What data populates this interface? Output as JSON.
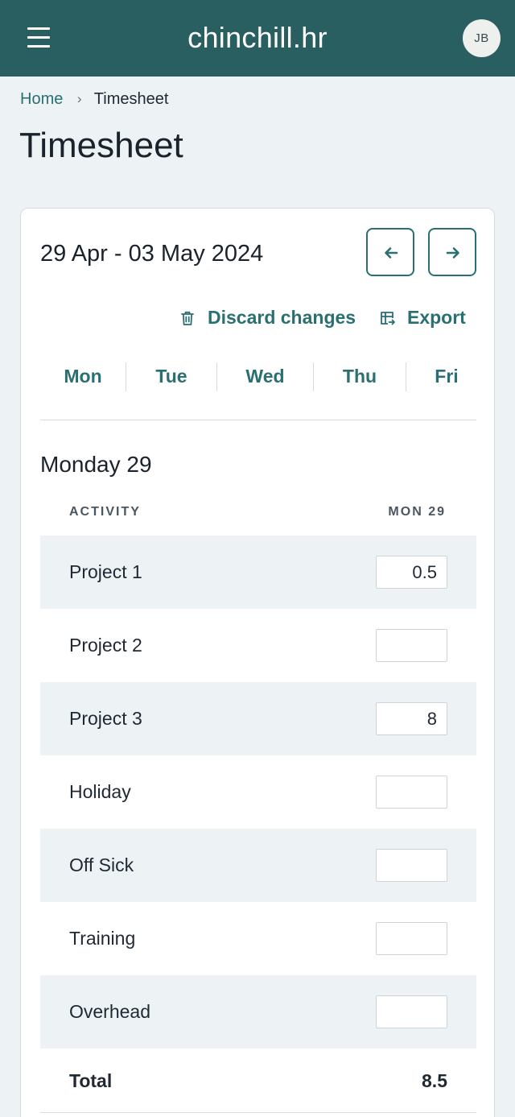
{
  "header": {
    "logo": "chinchill.hr",
    "avatar_initials": "JB"
  },
  "breadcrumb": {
    "home": "Home",
    "current": "Timesheet"
  },
  "page_title": "Timesheet",
  "week": {
    "range": "29 Apr - 03 May 2024",
    "discard_label": "Discard changes",
    "export_label": "Export",
    "days": [
      "Mon",
      "Tue",
      "Wed",
      "Thu",
      "Fri"
    ]
  },
  "day_view": {
    "heading": "Monday 29",
    "col_activity": "ACTIVITY",
    "col_day": "MON 29",
    "rows": [
      {
        "label": "Project 1",
        "value": "0.5"
      },
      {
        "label": "Project 2",
        "value": ""
      },
      {
        "label": "Project 3",
        "value": "8"
      },
      {
        "label": "Holiday",
        "value": ""
      },
      {
        "label": "Off Sick",
        "value": ""
      },
      {
        "label": "Training",
        "value": ""
      },
      {
        "label": "Overhead",
        "value": ""
      }
    ],
    "total_label": "Total",
    "total_value": "8.5"
  },
  "colors": {
    "brand": "#2a5f62",
    "accent": "#2a6f72",
    "row_shade": "#edf2f5"
  }
}
